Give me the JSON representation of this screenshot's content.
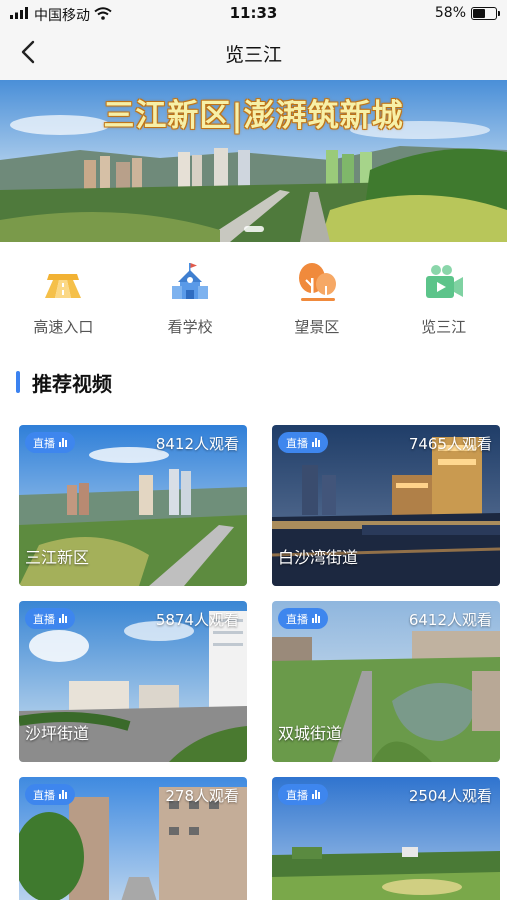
{
  "status_bar": {
    "carrier": "中国移动",
    "time": "11:33",
    "battery": "58%",
    "battery_level": 0.58,
    "icons": [
      "signal-icon",
      "wifi-icon",
      "battery-icon"
    ]
  },
  "nav": {
    "title": "览三江",
    "back_icon": "chevron-left-icon"
  },
  "banner": {
    "title": "三江新区|澎湃筑新城"
  },
  "quick_menu": [
    {
      "label": "高速入口",
      "icon": "highway-icon",
      "color": "#f2b233"
    },
    {
      "label": "看学校",
      "icon": "school-icon",
      "color": "#4a90e2"
    },
    {
      "label": "望景区",
      "icon": "tree-icon",
      "color": "#f08a3c"
    },
    {
      "label": "览三江",
      "icon": "video-camera-icon",
      "color": "#5cc48a"
    }
  ],
  "section": {
    "title": "推荐视频"
  },
  "videos": [
    {
      "badge": "直播",
      "viewers": "8412人观看",
      "name": "三江新区"
    },
    {
      "badge": "直播",
      "viewers": "7465人观看",
      "name": "白沙湾街道"
    },
    {
      "badge": "直播",
      "viewers": "5874人观看",
      "name": "沙坪街道"
    },
    {
      "badge": "直播",
      "viewers": "6412人观看",
      "name": "双城街道"
    },
    {
      "badge": "直播",
      "viewers": "278人观看",
      "name": ""
    },
    {
      "badge": "直播",
      "viewers": "2504人观看",
      "name": ""
    }
  ],
  "colors": {
    "accent": "#3b82f0",
    "live_badge": "#3e86ee"
  }
}
